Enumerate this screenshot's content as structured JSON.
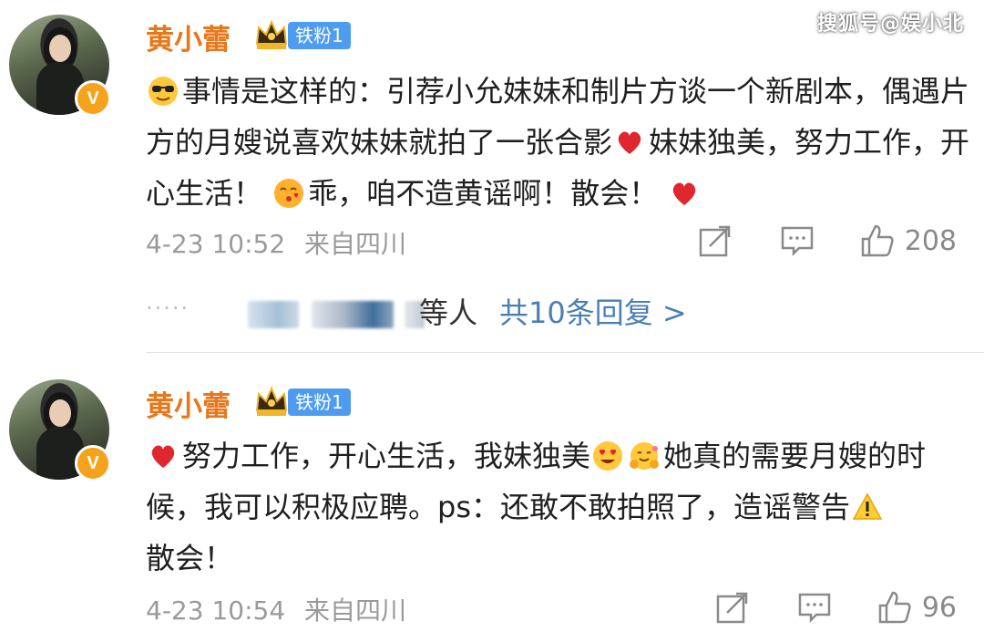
{
  "watermark": "搜狐号@娱小北",
  "comments": [
    {
      "username": "黄小蕾",
      "fan_badge": "铁粉1",
      "verified_mark": "V",
      "text_before_heart": "事情是这样的：引荐小允妹妹和制片方谈一个新剧本，偶遇片方的月嫂说喜欢妹妹就拍了一张合影",
      "text_after_heart": "妹妹独美，努力工作，开心生活！",
      "text_after_kiss": "乖，咱不造黄谣啊！散会！",
      "timestamp": "4-23 10:52",
      "location": "来自四川",
      "like_count": "208",
      "reply_person_suffix": "等人",
      "reply_link": "共10条回复 >",
      "reply_dots": "·····",
      "icons": [
        "sunglasses-emoji-icon",
        "heart-emoji-icon",
        "blowing-kiss-emoji-icon",
        "heart-emoji-icon",
        "repost-icon",
        "comment-icon",
        "thumbs-up-icon"
      ]
    },
    {
      "username": "黄小蕾",
      "fan_badge": "铁粉1",
      "verified_mark": "V",
      "text_line_a": "努力工作，开心生活，我妹独美",
      "text_line_b": "她真的需要月嫂的时候，我可以积极应聘。ps：还敢不敢拍照了，造谣警告",
      "text_line_c": "散会！",
      "timestamp": "4-23 10:54",
      "location": "来自四川",
      "like_count": "96",
      "icons": [
        "heart-emoji-icon",
        "heart-eyes-emoji-icon",
        "hugging-emoji-icon",
        "warning-emoji-icon",
        "repost-icon",
        "comment-icon",
        "thumbs-up-icon"
      ]
    }
  ],
  "colors": {
    "username": "#e8771c",
    "fan_badge": "#4d9cf0",
    "reply_link": "#4a7fb5",
    "meta": "#9a9a9a",
    "verified": "#f7a21b"
  }
}
